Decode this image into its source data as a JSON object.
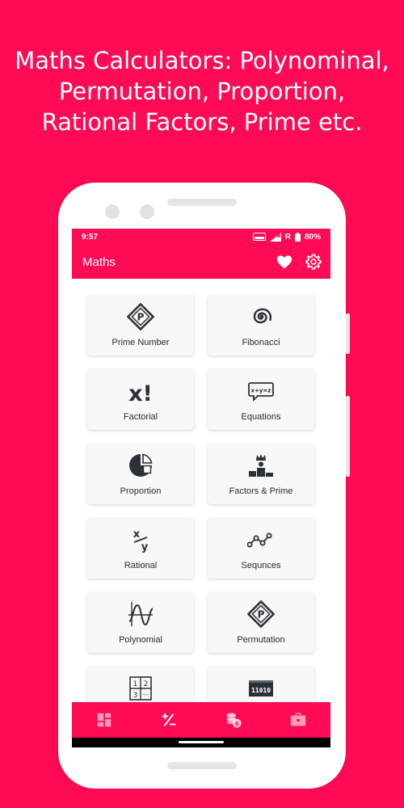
{
  "promo": {
    "line1": "Maths Calculators: Polynominal,",
    "line2": "Permutation, Proportion,",
    "line3": "Rational Factors, Prime etc."
  },
  "status_bar": {
    "time": "9:57",
    "battery": "80%",
    "roaming": "R"
  },
  "app_bar": {
    "title": "Maths",
    "favorite_icon": "heart-icon",
    "settings_icon": "gear-icon"
  },
  "calculators": [
    {
      "label": "Prime Number",
      "icon": "prime-p-diamond-icon"
    },
    {
      "label": "Fibonacci",
      "icon": "spiral-icon"
    },
    {
      "label": "Factorial",
      "icon": "factorial-x-icon"
    },
    {
      "label": "Equations",
      "icon": "equation-bubble-icon"
    },
    {
      "label": "Proportion",
      "icon": "pie-icon"
    },
    {
      "label": "Factors & Prime",
      "icon": "podium-crown-icon"
    },
    {
      "label": "Rational",
      "icon": "fraction-xy-icon"
    },
    {
      "label": "Sequnces",
      "icon": "sequence-icon"
    },
    {
      "label": "Polynomial",
      "icon": "graph-curve-icon"
    },
    {
      "label": "Permutation",
      "icon": "permutation-p-diamond-icon"
    },
    {
      "label": "",
      "icon": "matrix-grid-icon"
    },
    {
      "label": "",
      "icon": "binary-icon"
    }
  ],
  "bottom_nav": [
    {
      "name": "dashboard-icon"
    },
    {
      "name": "plus-minus-icon"
    },
    {
      "name": "coins-icon"
    },
    {
      "name": "briefcase-icon"
    }
  ],
  "colors": {
    "accent": "#ff0a54",
    "card_bg": "#f8f8f8",
    "icon": "#2b3036"
  },
  "icon_chars": {
    "factorial": "x!",
    "equation": "x+y=z",
    "fraction_x": "x",
    "fraction_y": "y",
    "matrix": [
      "1",
      "2",
      "3",
      "---"
    ],
    "binary": "11010",
    "prime_p": "P"
  }
}
